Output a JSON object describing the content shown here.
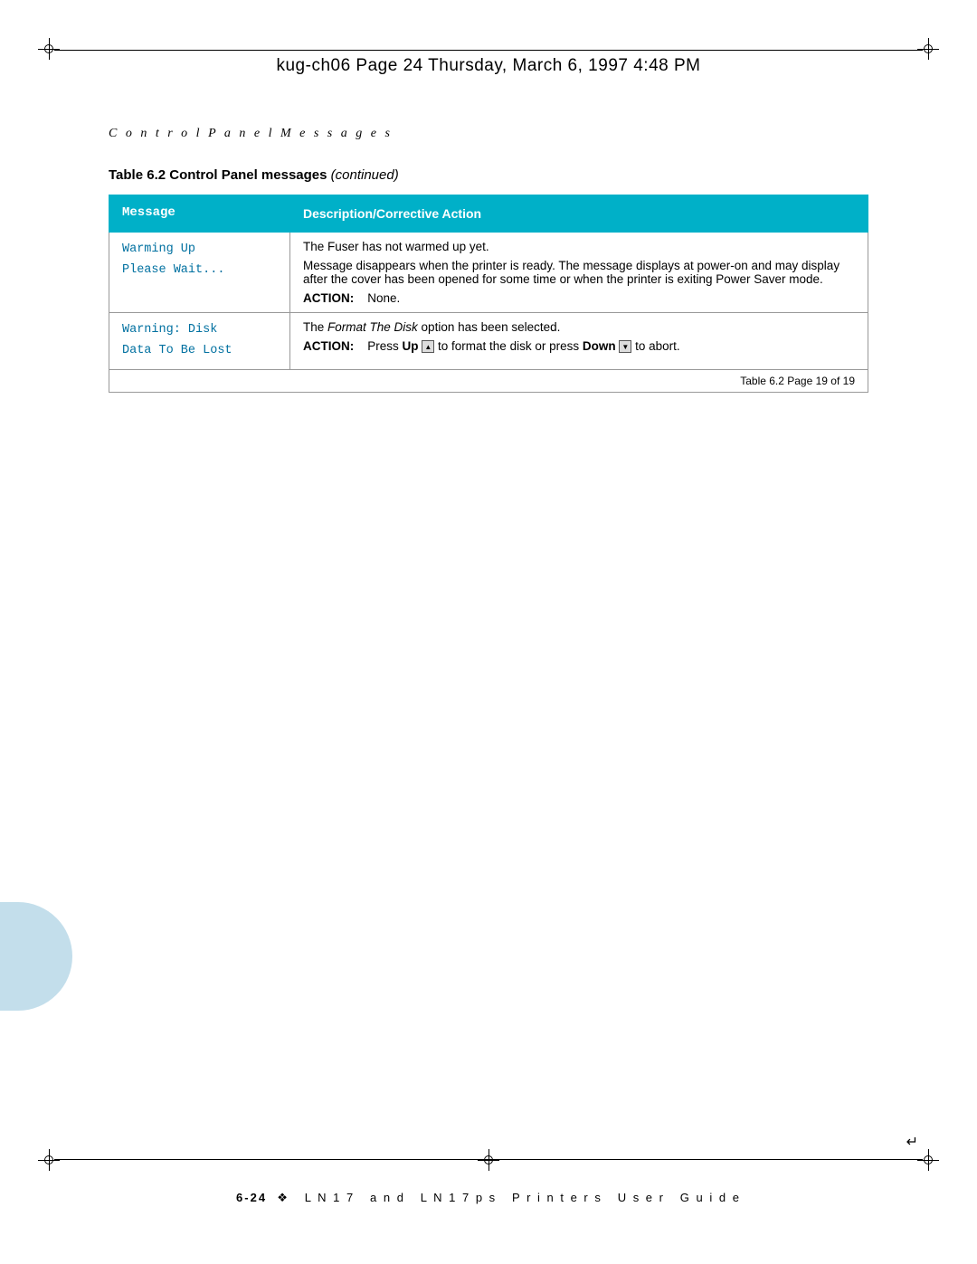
{
  "page": {
    "header": "kug-ch06  Page 24  Thursday, March 6, 1997  4:48 PM",
    "subtitle": "C o n t r o l   P a n e l   M e s s a g e s",
    "table_title": "Table 6.2   Control Panel messages",
    "table_title_continued": "(continued)",
    "footer": "6-24  ❖  L N 1 7  a n d  L N 1 7 p s  P r i n t e r s  U s e r  G u i d e",
    "table_page_note": "Table 6.2  Page 19 of 19"
  },
  "table": {
    "headers": {
      "col1": "Message",
      "col2": "Description/Corrective Action"
    },
    "rows": [
      {
        "message": "Warming Up\nPlease Wait...",
        "description_lines": [
          "The Fuser has not warmed up yet.",
          "Message disappears when the printer is ready. The message displays at power-on and may display after the cover has been opened for some time or when the printer is exiting Power Saver mode.",
          "ACTION:    None."
        ]
      },
      {
        "message": "Warning: Disk\nData To Be Lost",
        "description_lines": [
          "The Format The Disk option has been selected.",
          "ACTION:    Press Up ▲ to format the disk or press Down ▼ to abort."
        ]
      }
    ]
  },
  "icons": {
    "up_arrow": "▲",
    "down_arrow": "▼"
  }
}
